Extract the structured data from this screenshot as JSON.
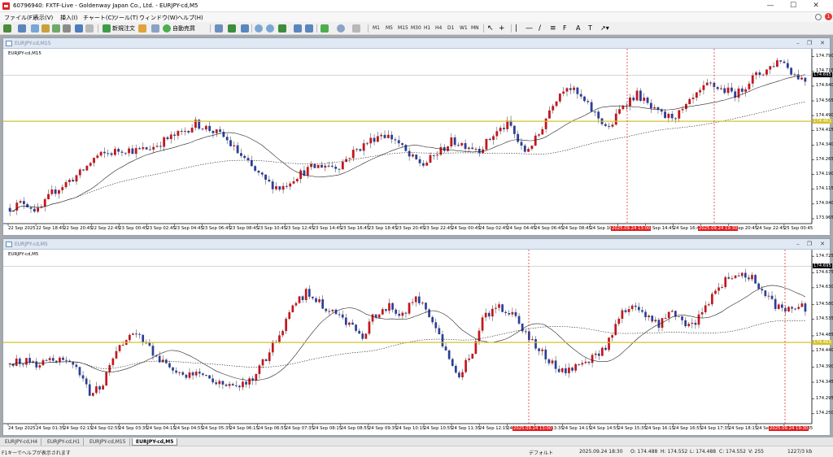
{
  "window": {
    "title": "60796940: FXTF-Live - Goldenway Japan Co., Ltd. - EURJPY-cd,M5",
    "minimize": "—",
    "maximize": "☐",
    "close": "✕"
  },
  "menu": [
    "ファイル(F)",
    "表示(V)",
    "挿入(I)",
    "チャート(C)",
    "ツール(T)",
    "ウィンドウ(W)",
    "ヘルプ(H)"
  ],
  "toolbar": {
    "new_order": "新規注文",
    "auto_trade": "自動売買",
    "timeframes": [
      "M1",
      "M5",
      "M15",
      "M30",
      "H1",
      "H4",
      "D1",
      "W1",
      "MN"
    ]
  },
  "colors": {
    "bull": "#c4161c",
    "bear": "#2b3f99",
    "line": "#d4c22c",
    "ma": "#222222",
    "bid_tag": "#000000",
    "hline_tag": "#d4c22c",
    "marker": "#e31b1b"
  },
  "chart_m15": {
    "caption": "EURJPY-cd,M15",
    "symbol_label": "EURJPY-cd,M15",
    "bid_price": "174.695",
    "hline_price": "174.461",
    "y_ticks": [
      "174.790",
      "174.715",
      "174.640",
      "174.565",
      "174.490",
      "174.415",
      "174.340",
      "174.265",
      "174.190",
      "174.115",
      "174.040",
      "173.965"
    ],
    "x_ticks": [
      "22 Sep 2025",
      "22 Sep 18:45",
      "22 Sep 20:45",
      "22 Sep 22:45",
      "23 Sep 00:45",
      "23 Sep 02:45",
      "23 Sep 04:45",
      "23 Sep 06:45",
      "23 Sep 08:45",
      "23 Sep 10:45",
      "23 Sep 12:45",
      "23 Sep 14:45",
      "23 Sep 16:45",
      "23 Sep 18:45",
      "23 Sep 20:45",
      "23 Sep 22:45",
      "24 Sep 00:45",
      "24 Sep 02:45",
      "24 Sep 04:45",
      "24 Sep 06:45",
      "24 Sep 08:45",
      "24 Sep 10:45",
      "24 Sep 12:45",
      "24 Sep 14:45",
      "24 Sep 16:45",
      "24 Sep 18:45",
      "24 Sep 20:45",
      "24 Sep 22:45",
      "25 Sep 00:45"
    ],
    "markers": [
      "2025.09.24 13:00",
      "2025.09.24 19:30"
    ],
    "chart_data": {
      "type": "candlestick",
      "timeframe": "M15",
      "ylim": [
        173.94,
        174.83
      ],
      "close_path": [
        174.02,
        174.05,
        174.0,
        174.1,
        174.15,
        174.2,
        174.28,
        174.3,
        174.32,
        174.31,
        174.33,
        174.37,
        174.4,
        174.45,
        174.42,
        174.38,
        174.3,
        174.22,
        174.15,
        174.12,
        174.18,
        174.22,
        174.24,
        174.23,
        174.3,
        174.35,
        174.4,
        174.37,
        174.28,
        174.24,
        174.3,
        174.36,
        174.34,
        174.32,
        174.4,
        174.45,
        174.3,
        174.38,
        174.55,
        174.65,
        174.58,
        174.5,
        174.42,
        174.55,
        174.6,
        174.52,
        174.48,
        174.5,
        174.58,
        174.65,
        174.62,
        174.6,
        174.68,
        174.72,
        174.78,
        174.7,
        174.66
      ]
    }
  },
  "chart_m5": {
    "caption": "EURJPY-cd,M5",
    "symbol_label": "EURJPY-cd,M5",
    "bid_price": "174.695",
    "hline_price": "174.465",
    "y_ticks": [
      "174.725",
      "174.675",
      "174.630",
      "174.580",
      "174.535",
      "174.485",
      "174.440",
      "174.390",
      "174.345",
      "174.295",
      "174.250"
    ],
    "x_ticks": [
      "24 Sep 2025",
      "24 Sep 01:35",
      "24 Sep 02:15",
      "24 Sep 02:55",
      "24 Sep 03:35",
      "24 Sep 04:15",
      "24 Sep 04:55",
      "24 Sep 05:35",
      "24 Sep 06:15",
      "24 Sep 06:55",
      "24 Sep 07:35",
      "24 Sep 08:15",
      "24 Sep 08:55",
      "24 Sep 09:35",
      "24 Sep 10:15",
      "24 Sep 10:55",
      "24 Sep 11:35",
      "24 Sep 12:15",
      "24 Sep 12:55",
      "24 Sep 13:35",
      "24 Sep 14:15",
      "24 Sep 14:55",
      "24 Sep 15:35",
      "24 Sep 16:15",
      "24 Sep 16:55",
      "24 Sep 17:35",
      "24 Sep 18:15",
      "24 Sep 18:55",
      "24 Sep 19:35"
    ],
    "markers": [
      "2025.09.24 13:00",
      "2025.09.24 19:30"
    ],
    "chart_data": {
      "type": "candlestick",
      "timeframe": "M5",
      "ylim": [
        174.22,
        174.745
      ],
      "close_path": [
        174.4,
        174.41,
        174.4,
        174.42,
        174.41,
        174.38,
        174.3,
        174.35,
        174.45,
        174.5,
        174.46,
        174.42,
        174.38,
        174.36,
        174.37,
        174.35,
        174.34,
        174.33,
        174.36,
        174.42,
        174.5,
        174.58,
        174.62,
        174.58,
        174.56,
        174.52,
        174.48,
        174.55,
        174.58,
        174.55,
        174.6,
        174.55,
        174.46,
        174.36,
        174.42,
        174.54,
        174.58,
        174.55,
        174.5,
        174.45,
        174.4,
        174.38,
        174.4,
        174.42,
        174.45,
        174.55,
        174.58,
        174.55,
        174.52,
        174.56,
        174.5,
        174.55,
        174.62,
        174.66,
        174.68,
        174.65,
        174.6,
        174.56,
        174.58,
        174.56
      ]
    }
  },
  "tabs": [
    "EURJPY-cd,H4",
    "EURJPY-cd,H1",
    "EURJPY-cd,M15",
    "EURJPY-cd,M5"
  ],
  "status": {
    "help": "F1キーでヘルプが表示されます",
    "profile": "デフォルト",
    "datetime": "2025.09.24 18:30",
    "open": "O: 174.488",
    "high": "H: 174.552",
    "low": "L: 174.488",
    "close": "C: 174.552",
    "volume": "V: 255",
    "traffic": "1227/3 kb"
  }
}
